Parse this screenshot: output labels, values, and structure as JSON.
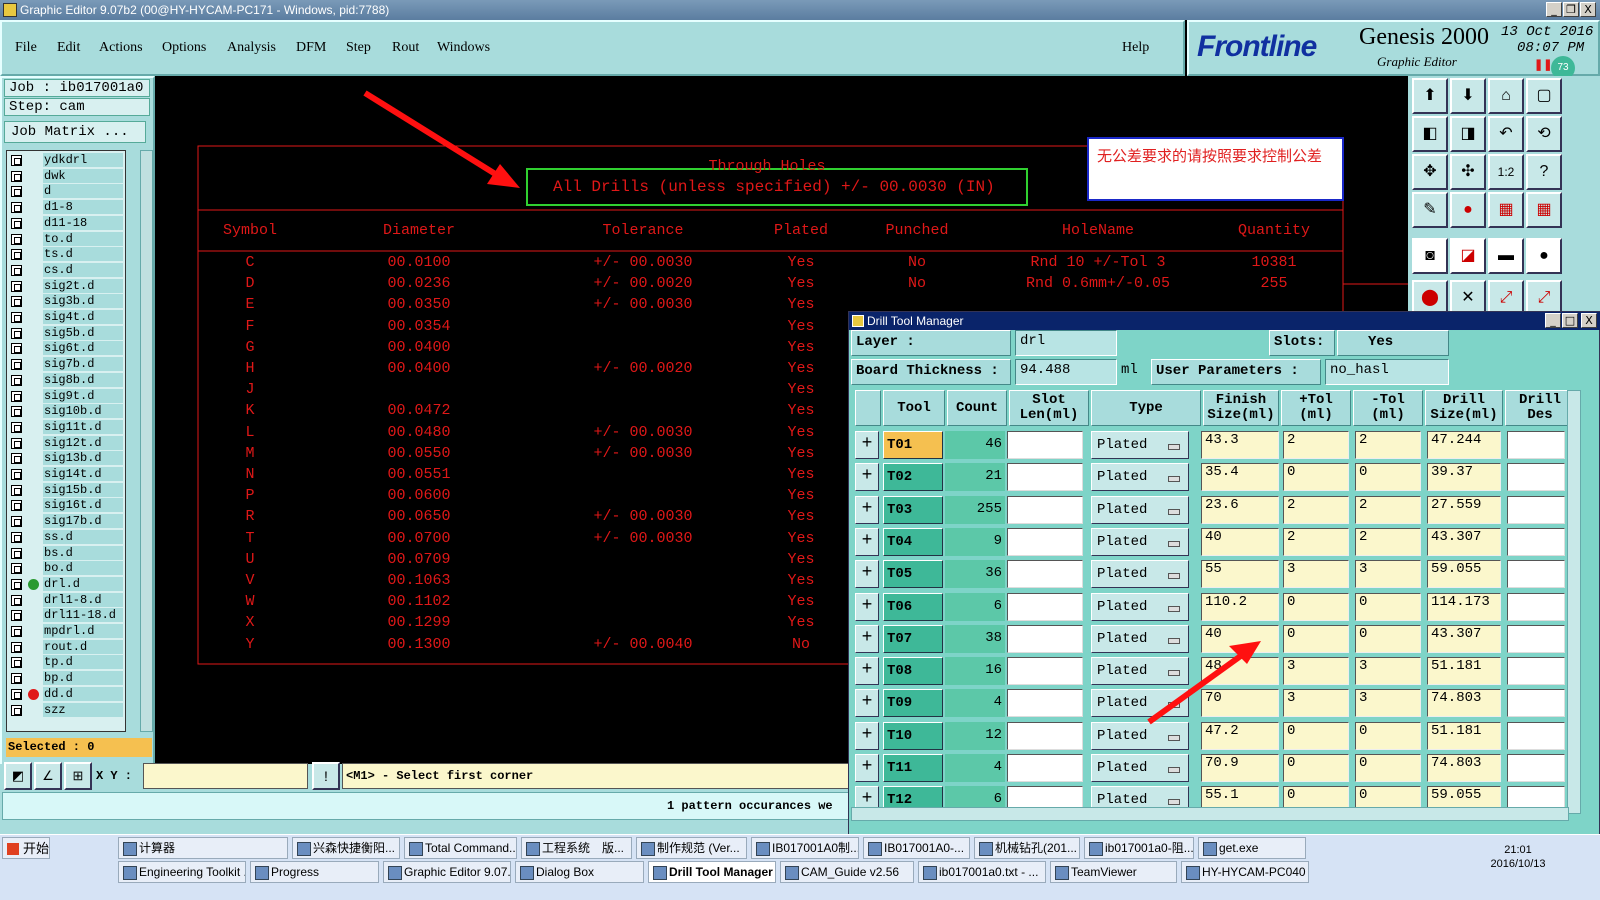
{
  "window": {
    "title": "Graphic Editor 9.07b2 (00@HY-HYCAM-PC171 - Windows, pid:7788)",
    "controls": [
      "_",
      "❐",
      "X"
    ]
  },
  "menu": {
    "items": [
      "File",
      "Edit",
      "Actions",
      "Options",
      "Analysis",
      "DFM",
      "Step",
      "Rout",
      "Windows"
    ],
    "help": "Help"
  },
  "brand": {
    "logo": "Frontline",
    "product": "Genesis 2000",
    "subtitle": "Graphic Editor",
    "date": "13 Oct 2016",
    "time": "08:07 PM",
    "badge": "73"
  },
  "job": {
    "job_label": "Job  : ib017001a0",
    "step_label": "Step: cam",
    "matrix_button": "Job Matrix ..."
  },
  "layers": [
    "ydkdrl",
    "dwk",
    "d",
    "d1-8",
    "d11-18",
    "to.d",
    "ts.d",
    "cs.d",
    "sig2t.d",
    "sig3b.d",
    "sig4t.d",
    "sig5b.d",
    "sig6t.d",
    "sig7b.d",
    "sig8b.d",
    "sig9t.d",
    "sig10b.d",
    "sig11t.d",
    "sig12t.d",
    "sig13b.d",
    "sig14t.d",
    "sig15b.d",
    "sig16t.d",
    "sig17b.d",
    "ss.d",
    "bs.d",
    "bo.d",
    "drl.d",
    "drl1-8.d",
    "drl11-18.d",
    "mpdrl.d",
    "rout.d",
    "tp.d",
    "bp.d",
    "dd.d",
    "szz"
  ],
  "selected": "Selected : 0",
  "drawing": {
    "title": "Through Holes",
    "note": "All Drills (unless specified) +/- 00.0030 (IN)",
    "headers": [
      "Symbol",
      "Diameter",
      "Tolerance",
      "Plated",
      "Punched",
      "HoleName",
      "Quantity"
    ],
    "rows": [
      [
        "C",
        "00.0100",
        "+/- 00.0030",
        "Yes",
        "No",
        "Rnd 10 +/-Tol 3",
        "10381"
      ],
      [
        "D",
        "00.0236",
        "+/- 00.0020",
        "Yes",
        "No",
        "Rnd 0.6mm+/-0.05",
        "255"
      ],
      [
        "E",
        "00.0350",
        "+/- 00.0030",
        "Yes",
        "",
        "",
        ""
      ],
      [
        "F",
        "00.0354",
        "",
        "Yes",
        "",
        "",
        ""
      ],
      [
        "G",
        "00.0400",
        "",
        "Yes",
        "",
        "",
        ""
      ],
      [
        "H",
        "00.0400",
        "+/- 00.0020",
        "Yes",
        "",
        "",
        ""
      ],
      [
        "J",
        "",
        "",
        "Yes",
        "",
        "",
        ""
      ],
      [
        "K",
        "00.0472",
        "",
        "Yes",
        "",
        "",
        ""
      ],
      [
        "L",
        "00.0480",
        "+/- 00.0030",
        "Yes",
        "",
        "",
        ""
      ],
      [
        "M",
        "00.0550",
        "+/- 00.0030",
        "Yes",
        "",
        "",
        ""
      ],
      [
        "N",
        "00.0551",
        "",
        "Yes",
        "",
        "",
        ""
      ],
      [
        "P",
        "00.0600",
        "",
        "Yes",
        "",
        "",
        ""
      ],
      [
        "R",
        "00.0650",
        "+/- 00.0030",
        "Yes",
        "",
        "",
        ""
      ],
      [
        "T",
        "00.0700",
        "+/- 00.0030",
        "Yes",
        "",
        "",
        ""
      ],
      [
        "U",
        "00.0709",
        "",
        "Yes",
        "",
        "",
        ""
      ],
      [
        "V",
        "00.1063",
        "",
        "Yes",
        "",
        "",
        ""
      ],
      [
        "W",
        "00.1102",
        "",
        "Yes",
        "",
        "",
        ""
      ],
      [
        "X",
        "00.1299",
        "",
        "Yes",
        "",
        "",
        ""
      ],
      [
        "Y",
        "00.1300",
        "+/- 00.0040",
        "No",
        "",
        "",
        ""
      ]
    ]
  },
  "annotation": {
    "text": "无公差要求的请按照要求控制公差"
  },
  "coord": {
    "label": "X Y :",
    "value": ""
  },
  "status": {
    "prompt": "<M1> - Select first corner",
    "message": "1 pattern occurances we"
  },
  "dialog": {
    "title": "Drill Tool Manager",
    "layer_label": "Layer                :",
    "layer_value": "drl",
    "slots_label": "Slots:",
    "slots_value": "Yes",
    "thickness_label": "Board Thickness :",
    "thickness_value": "94.488",
    "thickness_unit": "ml",
    "userparam_label": "User Parameters :",
    "userparam_value": "no_hasl",
    "headers": [
      "Tool",
      "Count",
      "Slot Len(ml)",
      "Type",
      "Finish Size(ml)",
      "+Tol (ml)",
      "-Tol (ml)",
      "Drill Size(ml)",
      "Drill Des"
    ],
    "rows": [
      {
        "tool": "T01",
        "count": "46",
        "type": "Plated",
        "finish": "43.3",
        "ptol": "2",
        "mtol": "2",
        "drill": "47.244"
      },
      {
        "tool": "T02",
        "count": "21",
        "type": "Plated",
        "finish": "35.4",
        "ptol": "0",
        "mtol": "0",
        "drill": "39.37"
      },
      {
        "tool": "T03",
        "count": "255",
        "type": "Plated",
        "finish": "23.6",
        "ptol": "2",
        "mtol": "2",
        "drill": "27.559"
      },
      {
        "tool": "T04",
        "count": "9",
        "type": "Plated",
        "finish": "40",
        "ptol": "2",
        "mtol": "2",
        "drill": "43.307"
      },
      {
        "tool": "T05",
        "count": "36",
        "type": "Plated",
        "finish": "55",
        "ptol": "3",
        "mtol": "3",
        "drill": "59.055"
      },
      {
        "tool": "T06",
        "count": "6",
        "type": "Plated",
        "finish": "110.2",
        "ptol": "0",
        "mtol": "0",
        "drill": "114.173"
      },
      {
        "tool": "T07",
        "count": "38",
        "type": "Plated",
        "finish": "40",
        "ptol": "0",
        "mtol": "0",
        "drill": "43.307"
      },
      {
        "tool": "T08",
        "count": "16",
        "type": "Plated",
        "finish": "48",
        "ptol": "3",
        "mtol": "3",
        "drill": "51.181"
      },
      {
        "tool": "T09",
        "count": "4",
        "type": "Plated",
        "finish": "70",
        "ptol": "3",
        "mtol": "3",
        "drill": "74.803"
      },
      {
        "tool": "T10",
        "count": "12",
        "type": "Plated",
        "finish": "47.2",
        "ptol": "0",
        "mtol": "0",
        "drill": "51.181"
      },
      {
        "tool": "T11",
        "count": "4",
        "type": "Plated",
        "finish": "70.9",
        "ptol": "0",
        "mtol": "0",
        "drill": "74.803"
      },
      {
        "tool": "T12",
        "count": "6",
        "type": "Plated",
        "finish": "55.1",
        "ptol": "0",
        "mtol": "0",
        "drill": "59.055"
      }
    ]
  },
  "taskbar": {
    "start": "开始",
    "row1": [
      "计算器",
      "兴森快捷衡阳...",
      "Total Command...",
      "工程系统　版...",
      "制作规范 (Ver...",
      "IB017001A0制...",
      "IB017001A0-...",
      "机械钻孔(201...",
      "ib017001a0-阻...",
      "get.exe"
    ],
    "row2": [
      "Engineering Toolkit ...",
      "Progress",
      "Graphic Editor 9.07...",
      "Dialog Box",
      "Drill Tool Manager",
      "CAM_Guide v2.56",
      "ib017001a0.txt - ...",
      "TeamViewer",
      "HY-HYCAM-PC040 -..."
    ],
    "clock": "21:01",
    "date": "2016/10/13"
  },
  "colors": {
    "accent": "#a8dcdc",
    "drawing": "#e01818",
    "selected_tool": "#f5c050"
  }
}
